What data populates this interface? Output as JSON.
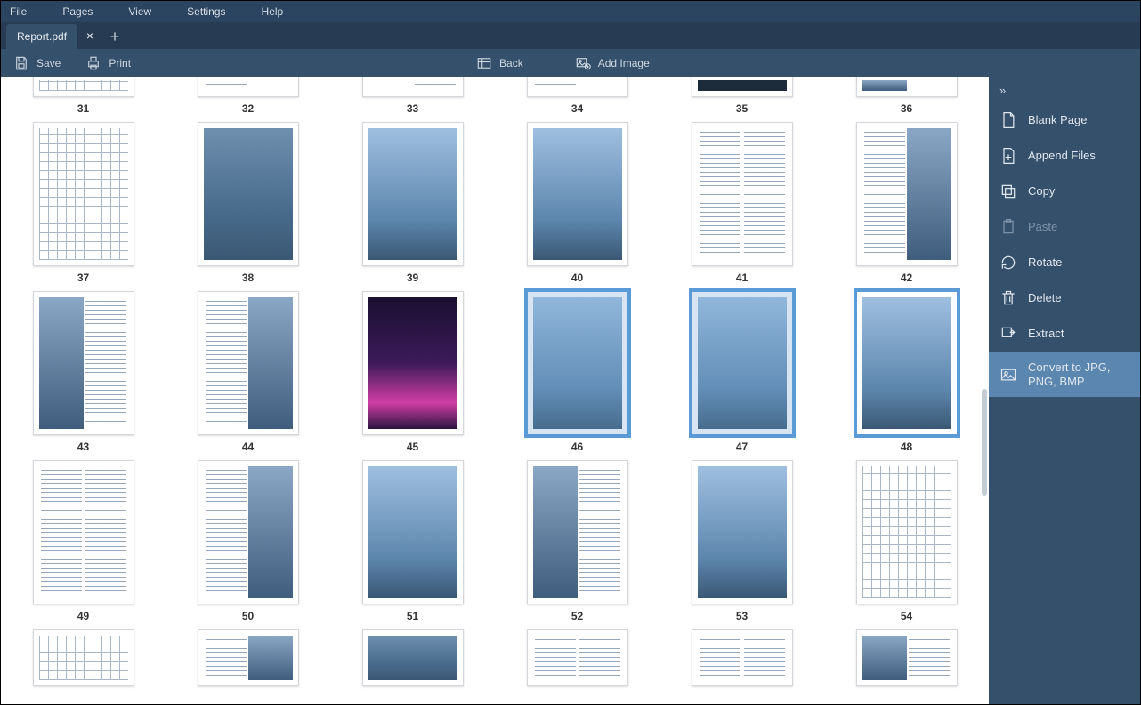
{
  "menu": {
    "file": "File",
    "pages": "Pages",
    "view": "View",
    "settings": "Settings",
    "help": "Help"
  },
  "tab": {
    "title": "Report.pdf"
  },
  "toolbar": {
    "save": "Save",
    "print": "Print",
    "back": "Back",
    "add_image": "Add Image"
  },
  "pages": {
    "row0": [
      "31",
      "32",
      "33",
      "34",
      "35",
      "36"
    ],
    "row1": [
      "37",
      "38",
      "39",
      "40",
      "41",
      "42"
    ],
    "row2": [
      "43",
      "44",
      "45",
      "46",
      "47",
      "48"
    ],
    "row3": [
      "49",
      "50",
      "51",
      "52",
      "53",
      "54"
    ]
  },
  "selected_pages": [
    "46",
    "47",
    "48"
  ],
  "sidebar": {
    "blank": "Blank Page",
    "append": "Append Files",
    "copy": "Copy",
    "paste": "Paste",
    "rotate": "Rotate",
    "delete": "Delete",
    "extract": "Extract",
    "convert": "Convert to JPG, PNG, BMP"
  }
}
